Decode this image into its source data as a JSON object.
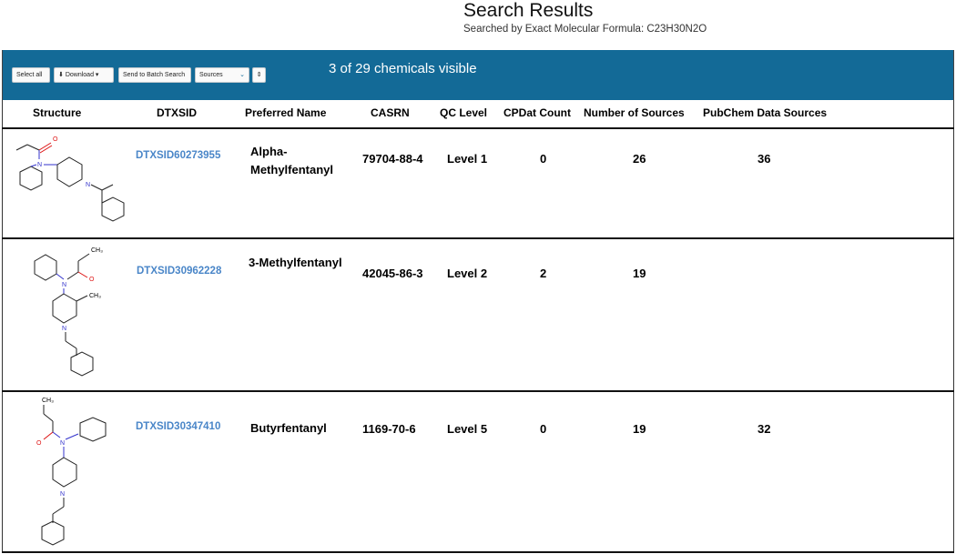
{
  "header": {
    "title": "Search Results",
    "subtitle": "Searched by Exact Molecular Formula: C23H30N2O"
  },
  "toolbar": {
    "select_all": "Select all",
    "download": "Download",
    "send_batch": "Send to Batch Search",
    "sources_selected": "Sources",
    "visible_count": "3 of 29 chemicals visible",
    "bar_color": "#136a97"
  },
  "columns": {
    "structure": "Structure",
    "dtxsid": "DTXSID",
    "preferred_name": "Preferred Name",
    "casrn": "CASRN",
    "qc_level": "QC Level",
    "cpdat_count": "CPDat Count",
    "num_sources": "Number of Sources",
    "pubchem": "PubChem Data Sources"
  },
  "rows": [
    {
      "dtxsid": "DTXSID60273955",
      "name": "Alpha-Methylfentanyl",
      "casrn": "79704-88-4",
      "qc": "Level 1",
      "cpdat": "0",
      "sources": "26",
      "pubchem": "36"
    },
    {
      "dtxsid": "DTXSID30962228",
      "name": "3-Methylfentanyl",
      "casrn": "42045-86-3",
      "qc": "Level 2",
      "cpdat": "2",
      "sources": "19",
      "pubchem": ""
    },
    {
      "dtxsid": "DTXSID30347410",
      "name": "Butyrfentanyl",
      "casrn": "1169-70-6",
      "qc": "Level 5",
      "cpdat": "0",
      "sources": "19",
      "pubchem": "32"
    }
  ],
  "structure_labels": {
    "o": "O",
    "n": "N",
    "ch3": "CH₃"
  },
  "icons": {
    "download": "download-icon",
    "dropdown": "chevron-down-icon",
    "sort": "sort-icon"
  }
}
